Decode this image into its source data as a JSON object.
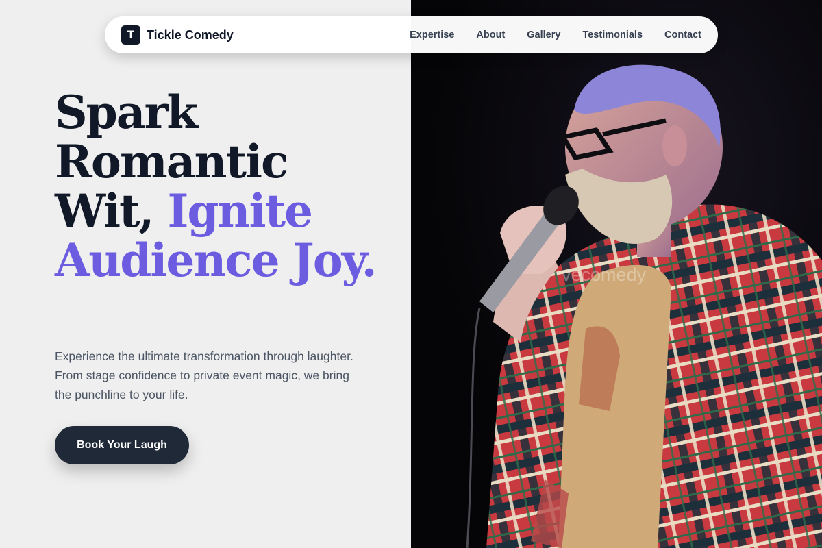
{
  "brand": {
    "logo_letter": "T",
    "name": "Tickle Comedy"
  },
  "nav": {
    "links": [
      {
        "label": "Expertise"
      },
      {
        "label": "About"
      },
      {
        "label": "Gallery"
      },
      {
        "label": "Testimonials"
      },
      {
        "label": "Contact"
      }
    ]
  },
  "hero": {
    "title_plain": "Spark Romantic Wit,",
    "title_accent": "Ignite Audience Joy.",
    "subtitle": "Experience the ultimate transformation through laughter. From stage confidence to private event magic, we bring the punchline to your life.",
    "cta_label": "Book Your Laugh"
  },
  "photo": {
    "watermark": "vecomedy"
  },
  "colors": {
    "accent": "#6b5ce0",
    "dark": "#111827",
    "button": "#1f2937",
    "photo_bg": "#050507"
  }
}
